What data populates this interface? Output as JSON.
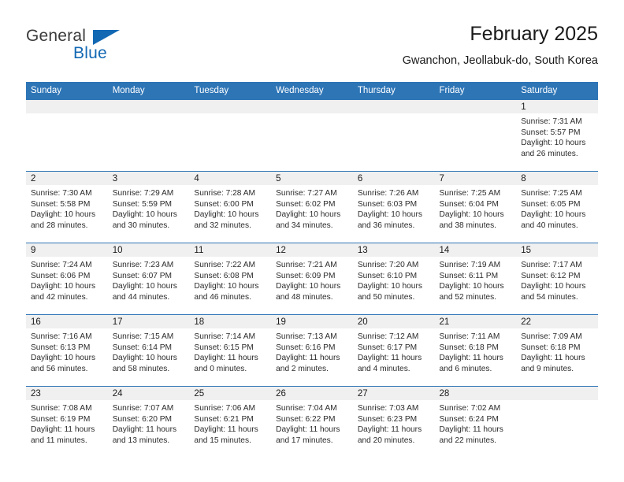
{
  "brand": {
    "name_top": "General",
    "name_bottom": "Blue",
    "accent_color": "#1268b3"
  },
  "header": {
    "title": "February 2025",
    "subtitle": "Gwanchon, Jeollabuk-do, South Korea"
  },
  "colors": {
    "header_row_bg": "#2e75b6",
    "header_row_text": "#ffffff",
    "daynum_band_bg": "#f0f0f0",
    "row_divider": "#2e75b6",
    "body_text": "#2b2b2b"
  },
  "weekdays": [
    "Sunday",
    "Monday",
    "Tuesday",
    "Wednesday",
    "Thursday",
    "Friday",
    "Saturday"
  ],
  "weeks": [
    [
      {
        "day": "",
        "lines": []
      },
      {
        "day": "",
        "lines": []
      },
      {
        "day": "",
        "lines": []
      },
      {
        "day": "",
        "lines": []
      },
      {
        "day": "",
        "lines": []
      },
      {
        "day": "",
        "lines": []
      },
      {
        "day": "1",
        "lines": [
          "Sunrise: 7:31 AM",
          "Sunset: 5:57 PM",
          "Daylight: 10 hours",
          "and 26 minutes."
        ]
      }
    ],
    [
      {
        "day": "2",
        "lines": [
          "Sunrise: 7:30 AM",
          "Sunset: 5:58 PM",
          "Daylight: 10 hours",
          "and 28 minutes."
        ]
      },
      {
        "day": "3",
        "lines": [
          "Sunrise: 7:29 AM",
          "Sunset: 5:59 PM",
          "Daylight: 10 hours",
          "and 30 minutes."
        ]
      },
      {
        "day": "4",
        "lines": [
          "Sunrise: 7:28 AM",
          "Sunset: 6:00 PM",
          "Daylight: 10 hours",
          "and 32 minutes."
        ]
      },
      {
        "day": "5",
        "lines": [
          "Sunrise: 7:27 AM",
          "Sunset: 6:02 PM",
          "Daylight: 10 hours",
          "and 34 minutes."
        ]
      },
      {
        "day": "6",
        "lines": [
          "Sunrise: 7:26 AM",
          "Sunset: 6:03 PM",
          "Daylight: 10 hours",
          "and 36 minutes."
        ]
      },
      {
        "day": "7",
        "lines": [
          "Sunrise: 7:25 AM",
          "Sunset: 6:04 PM",
          "Daylight: 10 hours",
          "and 38 minutes."
        ]
      },
      {
        "day": "8",
        "lines": [
          "Sunrise: 7:25 AM",
          "Sunset: 6:05 PM",
          "Daylight: 10 hours",
          "and 40 minutes."
        ]
      }
    ],
    [
      {
        "day": "9",
        "lines": [
          "Sunrise: 7:24 AM",
          "Sunset: 6:06 PM",
          "Daylight: 10 hours",
          "and 42 minutes."
        ]
      },
      {
        "day": "10",
        "lines": [
          "Sunrise: 7:23 AM",
          "Sunset: 6:07 PM",
          "Daylight: 10 hours",
          "and 44 minutes."
        ]
      },
      {
        "day": "11",
        "lines": [
          "Sunrise: 7:22 AM",
          "Sunset: 6:08 PM",
          "Daylight: 10 hours",
          "and 46 minutes."
        ]
      },
      {
        "day": "12",
        "lines": [
          "Sunrise: 7:21 AM",
          "Sunset: 6:09 PM",
          "Daylight: 10 hours",
          "and 48 minutes."
        ]
      },
      {
        "day": "13",
        "lines": [
          "Sunrise: 7:20 AM",
          "Sunset: 6:10 PM",
          "Daylight: 10 hours",
          "and 50 minutes."
        ]
      },
      {
        "day": "14",
        "lines": [
          "Sunrise: 7:19 AM",
          "Sunset: 6:11 PM",
          "Daylight: 10 hours",
          "and 52 minutes."
        ]
      },
      {
        "day": "15",
        "lines": [
          "Sunrise: 7:17 AM",
          "Sunset: 6:12 PM",
          "Daylight: 10 hours",
          "and 54 minutes."
        ]
      }
    ],
    [
      {
        "day": "16",
        "lines": [
          "Sunrise: 7:16 AM",
          "Sunset: 6:13 PM",
          "Daylight: 10 hours",
          "and 56 minutes."
        ]
      },
      {
        "day": "17",
        "lines": [
          "Sunrise: 7:15 AM",
          "Sunset: 6:14 PM",
          "Daylight: 10 hours",
          "and 58 minutes."
        ]
      },
      {
        "day": "18",
        "lines": [
          "Sunrise: 7:14 AM",
          "Sunset: 6:15 PM",
          "Daylight: 11 hours",
          "and 0 minutes."
        ]
      },
      {
        "day": "19",
        "lines": [
          "Sunrise: 7:13 AM",
          "Sunset: 6:16 PM",
          "Daylight: 11 hours",
          "and 2 minutes."
        ]
      },
      {
        "day": "20",
        "lines": [
          "Sunrise: 7:12 AM",
          "Sunset: 6:17 PM",
          "Daylight: 11 hours",
          "and 4 minutes."
        ]
      },
      {
        "day": "21",
        "lines": [
          "Sunrise: 7:11 AM",
          "Sunset: 6:18 PM",
          "Daylight: 11 hours",
          "and 6 minutes."
        ]
      },
      {
        "day": "22",
        "lines": [
          "Sunrise: 7:09 AM",
          "Sunset: 6:18 PM",
          "Daylight: 11 hours",
          "and 9 minutes."
        ]
      }
    ],
    [
      {
        "day": "23",
        "lines": [
          "Sunrise: 7:08 AM",
          "Sunset: 6:19 PM",
          "Daylight: 11 hours",
          "and 11 minutes."
        ]
      },
      {
        "day": "24",
        "lines": [
          "Sunrise: 7:07 AM",
          "Sunset: 6:20 PM",
          "Daylight: 11 hours",
          "and 13 minutes."
        ]
      },
      {
        "day": "25",
        "lines": [
          "Sunrise: 7:06 AM",
          "Sunset: 6:21 PM",
          "Daylight: 11 hours",
          "and 15 minutes."
        ]
      },
      {
        "day": "26",
        "lines": [
          "Sunrise: 7:04 AM",
          "Sunset: 6:22 PM",
          "Daylight: 11 hours",
          "and 17 minutes."
        ]
      },
      {
        "day": "27",
        "lines": [
          "Sunrise: 7:03 AM",
          "Sunset: 6:23 PM",
          "Daylight: 11 hours",
          "and 20 minutes."
        ]
      },
      {
        "day": "28",
        "lines": [
          "Sunrise: 7:02 AM",
          "Sunset: 6:24 PM",
          "Daylight: 11 hours",
          "and 22 minutes."
        ]
      },
      {
        "day": "",
        "lines": []
      }
    ]
  ]
}
